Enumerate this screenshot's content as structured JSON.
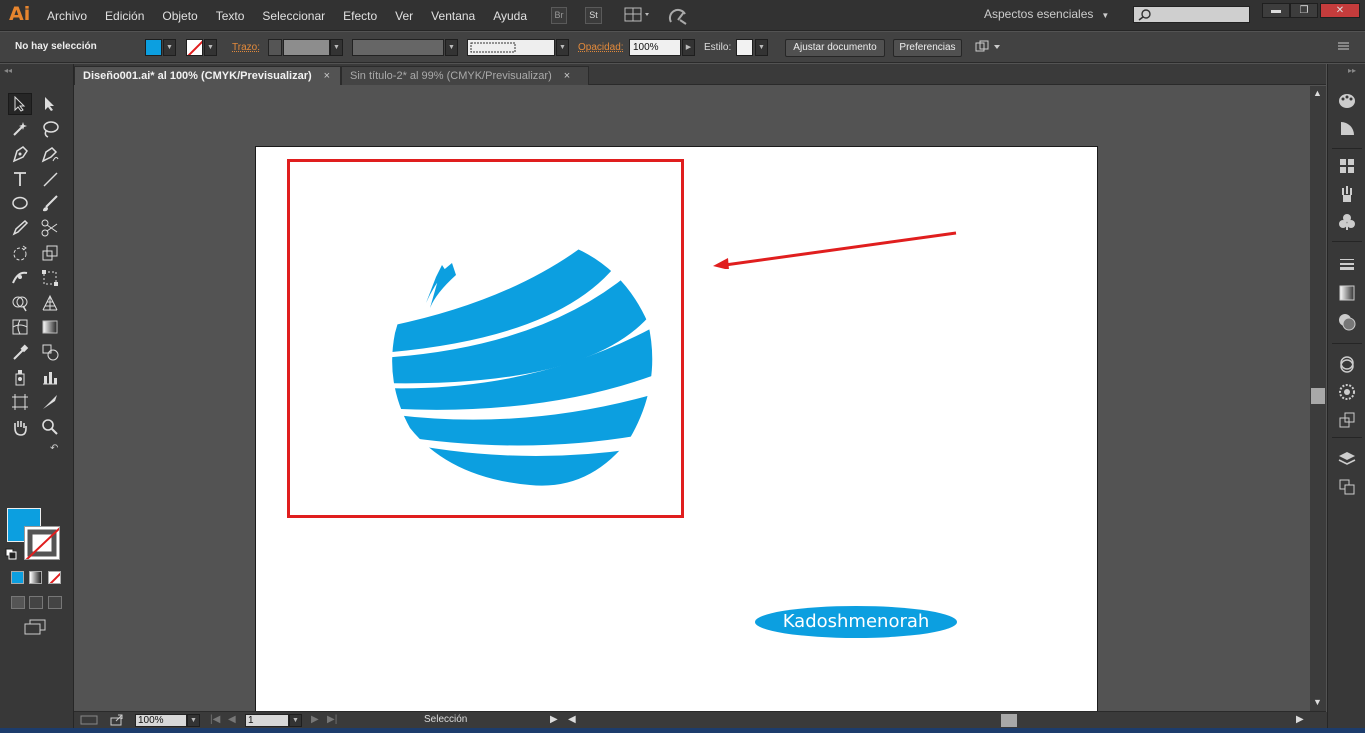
{
  "app": {
    "logo": "Ai",
    "workspace": "Aspectos esenciales"
  },
  "menu": [
    "Archivo",
    "Edición",
    "Objeto",
    "Texto",
    "Seleccionar",
    "Efecto",
    "Ver",
    "Ventana",
    "Ayuda"
  ],
  "menu_icons": {
    "bridge": "Br",
    "stock": "St"
  },
  "control": {
    "selection_status": "No hay selección",
    "stroke_label": "Trazo:",
    "opacity_label": "Opacidad:",
    "opacity_value": "100%",
    "style_label": "Estilo:",
    "adjust_doc": "Ajustar documento",
    "preferences": "Preferencias"
  },
  "tabs": [
    {
      "label": "Diseño001.ai* al 100% (CMYK/Previsualizar)",
      "close": "×"
    },
    {
      "label": "Sin título-2* al 99% (CMYK/Previsualizar)",
      "close": "×"
    }
  ],
  "status": {
    "zoom": "100%",
    "artboard_num": "1",
    "tool": "Selección"
  },
  "artwork": {
    "badge_text": "Kadoshmenorah"
  },
  "colors": {
    "fill": "#0c9fe0",
    "highlight": "#e01e1e",
    "accent": "#e7852e"
  }
}
